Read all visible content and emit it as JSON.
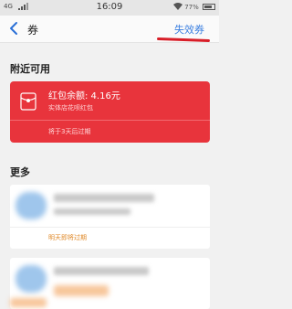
{
  "status_bar": {
    "network": "4G",
    "time": "16:09",
    "battery": "77%"
  },
  "nav": {
    "title": "券",
    "expired_tab": "失效券"
  },
  "sections": {
    "nearby": "附近可用",
    "more": "更多"
  },
  "red_packet": {
    "amount": "红包余额: 4.16元",
    "description": "实体店花呗红包",
    "expiry": "将于3天后过期"
  },
  "coupons": [
    {
      "expiry": "明天即将过期"
    }
  ],
  "colors": {
    "red_card": "#e8343c",
    "link_blue": "#3a7fe0",
    "warning_orange": "#e08a2a"
  }
}
